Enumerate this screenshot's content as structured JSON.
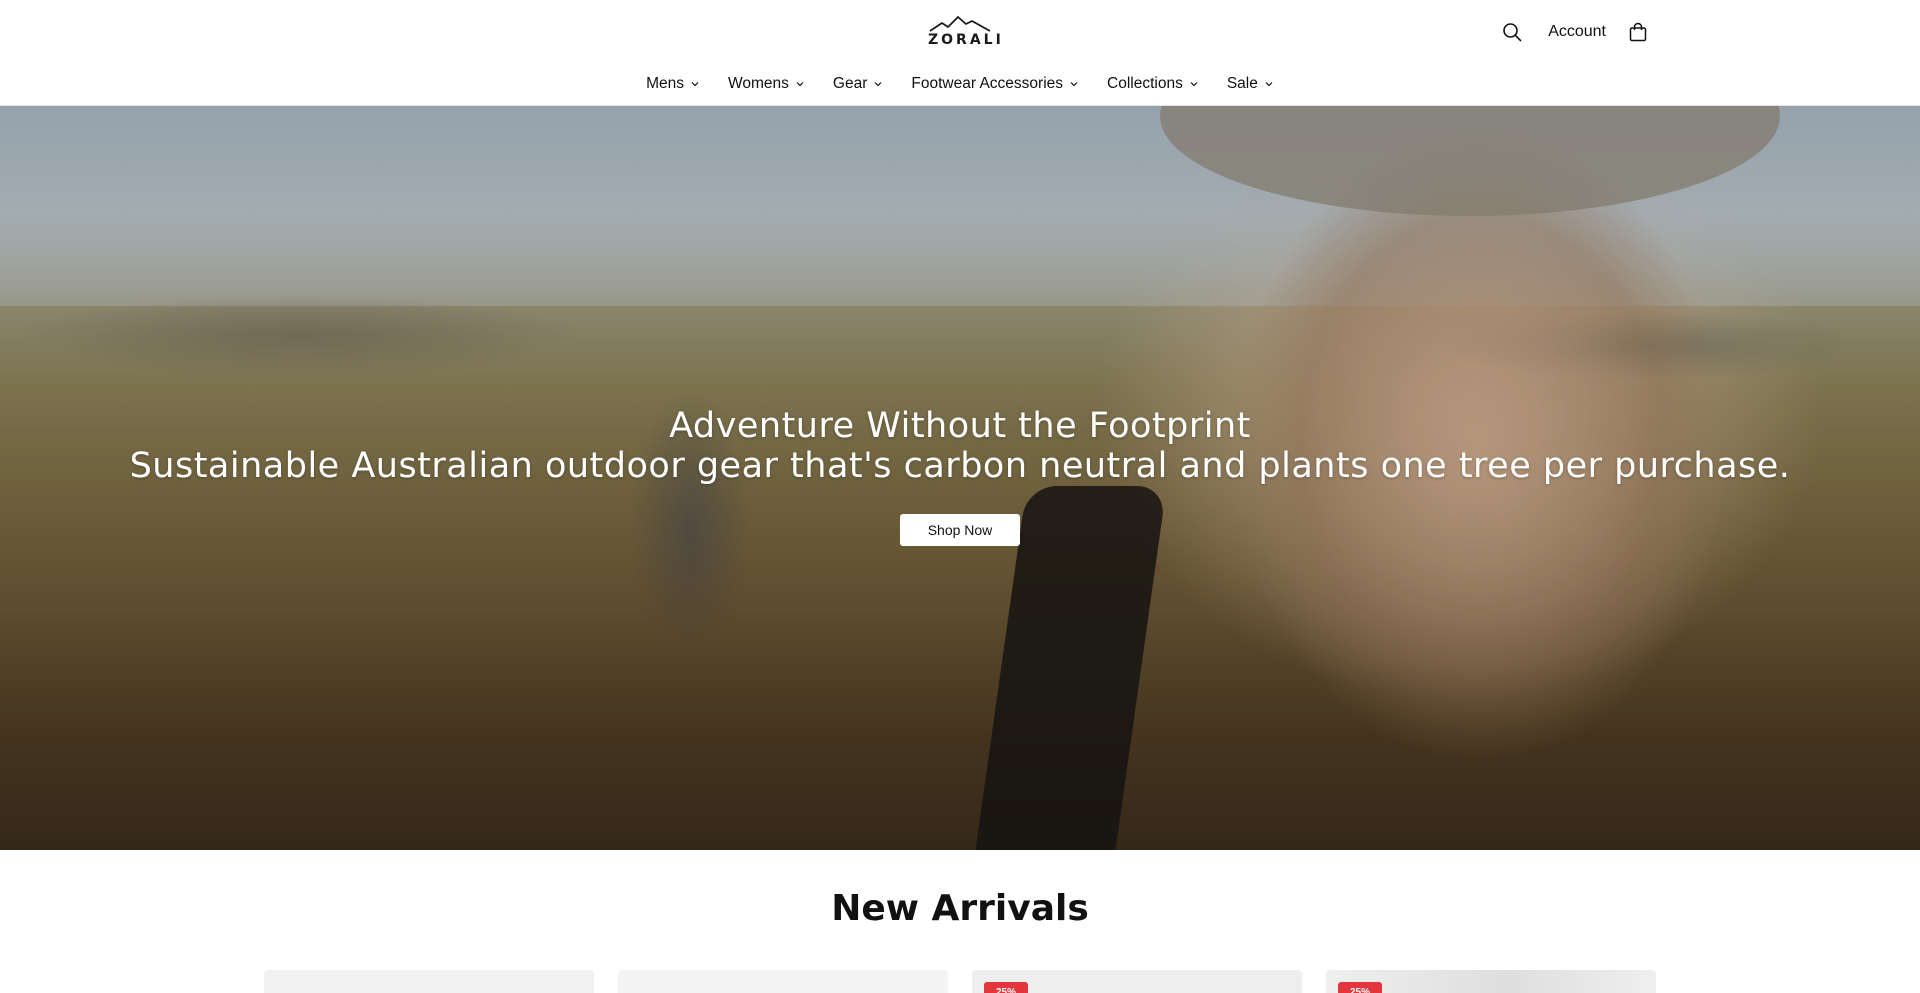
{
  "brand": {
    "name": "ZORALI"
  },
  "header": {
    "account_label": "Account",
    "icons": {
      "search": "search-icon",
      "cart": "shopping-bag-icon"
    }
  },
  "nav": {
    "items": [
      {
        "label": "Mens"
      },
      {
        "label": "Womens"
      },
      {
        "label": "Gear"
      },
      {
        "label": "Footwear Accessories"
      },
      {
        "label": "Collections"
      },
      {
        "label": "Sale"
      }
    ]
  },
  "hero": {
    "title": "Adventure Without the Footprint",
    "subtitle": "Sustainable Australian outdoor gear that's carbon neutral and plants one tree per purchase.",
    "cta_label": "Shop Now"
  },
  "new_arrivals": {
    "title": "New Arrivals",
    "cards": [
      {
        "badge": ""
      },
      {
        "badge": ""
      },
      {
        "badge": "25%"
      },
      {
        "badge": "25%"
      }
    ]
  },
  "colors": {
    "sale_badge": "#e0363c",
    "text": "#111111"
  }
}
